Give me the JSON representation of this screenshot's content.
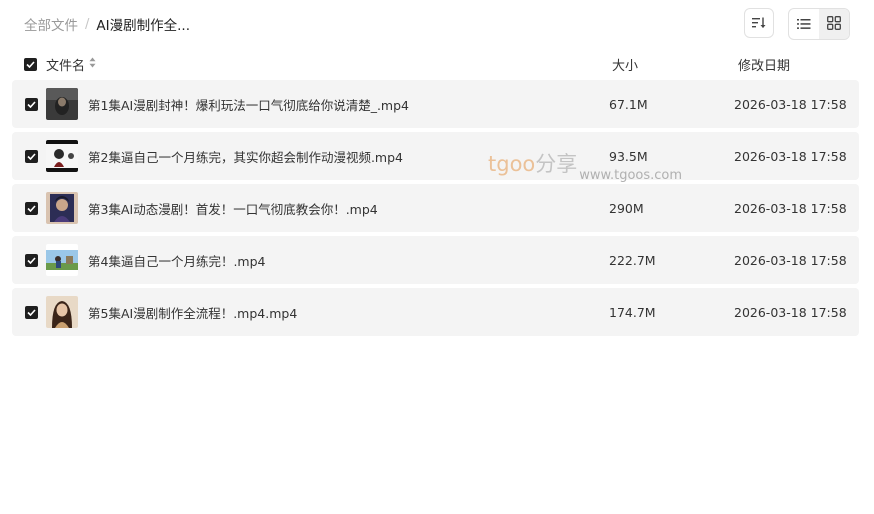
{
  "breadcrumb": {
    "root": "全部文件",
    "separator": "/",
    "current": "AI漫剧制作全..."
  },
  "toolbar": {
    "sort_icon": "sort-icon",
    "list_view_icon": "list-view-icon",
    "grid_view_icon": "grid-view-icon",
    "active_view": "list"
  },
  "header": {
    "name": "文件名",
    "size": "大小",
    "date": "修改日期"
  },
  "files": [
    {
      "name": "第1集AI漫剧封神！爆利玩法一口气彻底给你说清楚_.mp4",
      "size": "67.1M",
      "date": "2026-03-18 17:58",
      "checked": true
    },
    {
      "name": "第2集逼自己一个月练完，其实你超会制作动漫视频.mp4",
      "size": "93.5M",
      "date": "2026-03-18 17:58",
      "checked": true
    },
    {
      "name": "第3集AI动态漫剧！首发！一口气彻底教会你！.mp4",
      "size": "290M",
      "date": "2026-03-18 17:58",
      "checked": true
    },
    {
      "name": "第4集逼自己一个月练完！.mp4",
      "size": "222.7M",
      "date": "2026-03-18 17:58",
      "checked": true
    },
    {
      "name": "第5集AI漫剧制作全流程！.mp4.mp4",
      "size": "174.7M",
      "date": "2026-03-18 17:58",
      "checked": true
    }
  ],
  "watermark": {
    "logo_text": "tgoo",
    "logo_text2": "分享",
    "url": "www.tgoos.com"
  },
  "colors": {
    "row_bg": "#f4f4f4",
    "checkbox": "#1f1f1f",
    "watermark_orange": "#e8b07a"
  }
}
